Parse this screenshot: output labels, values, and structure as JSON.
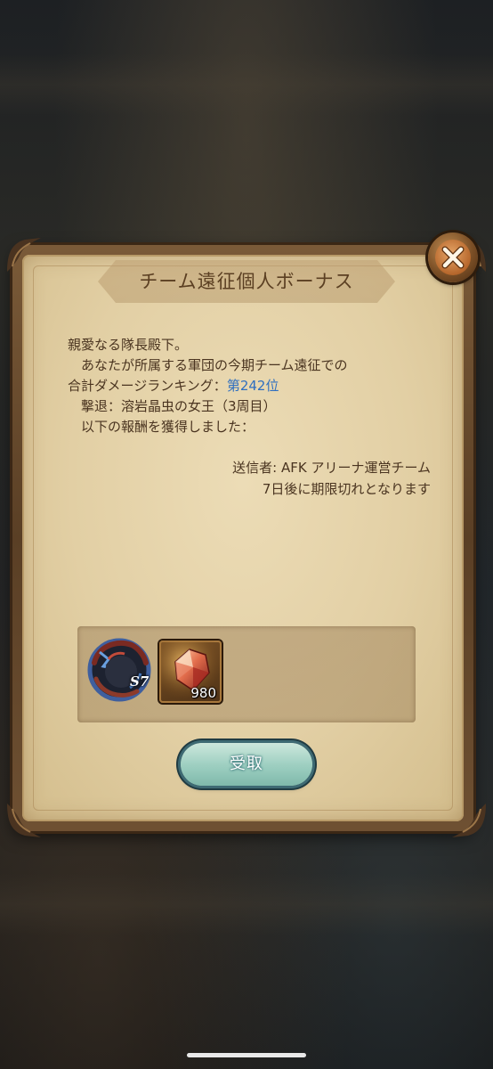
{
  "dialog": {
    "title": "チーム遠征個人ボーナス",
    "greeting": "親愛なる隊長殿下。",
    "line2": "あなたが所属する軍団の今期チーム遠征での",
    "ranking_label": "合計ダメージランキング：",
    "ranking_value": "第242位",
    "defeat_line": "撃退：溶岩晶虫の女王（3周目）",
    "reward_line": "以下の報酬を獲得しました：",
    "sender": "送信者: AFK アリーナ運営チーム",
    "expiry": "7日後に期限切れとなります"
  },
  "rewards": [
    {
      "icon": "season-badge-icon",
      "label": "S7"
    },
    {
      "icon": "red-crystal-icon",
      "quantity": "980"
    }
  ],
  "buttons": {
    "receive_label": "受取",
    "close_icon": "close-x-icon"
  },
  "colors": {
    "rank_highlight": "#2f6fc0",
    "parchment": "#e2cfa4",
    "receive_button": "#9fd0c2"
  }
}
